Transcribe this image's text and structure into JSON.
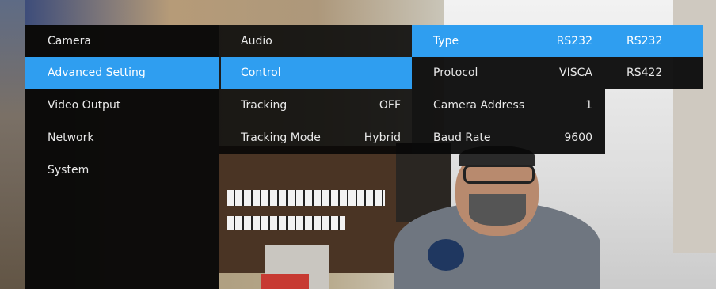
{
  "menu": {
    "col1": [
      {
        "label": "Camera"
      },
      {
        "label": "Advanced Setting"
      },
      {
        "label": "Video Output"
      },
      {
        "label": "Network"
      },
      {
        "label": "System"
      }
    ],
    "col2": [
      {
        "label": "Audio",
        "value": ""
      },
      {
        "label": "Control",
        "value": ""
      },
      {
        "label": "Tracking",
        "value": "OFF"
      },
      {
        "label": "Tracking Mode",
        "value": "Hybrid"
      }
    ],
    "col3": [
      {
        "label": "Type",
        "value": "RS232"
      },
      {
        "label": "Protocol",
        "value": "VISCA"
      },
      {
        "label": "Camera Address",
        "value": "1"
      },
      {
        "label": "Baud Rate",
        "value": "9600"
      }
    ],
    "col4": [
      {
        "label": "RS232"
      },
      {
        "label": "RS422"
      }
    ]
  },
  "colors": {
    "highlight": "#2f9ef0",
    "panel": "#080808"
  }
}
